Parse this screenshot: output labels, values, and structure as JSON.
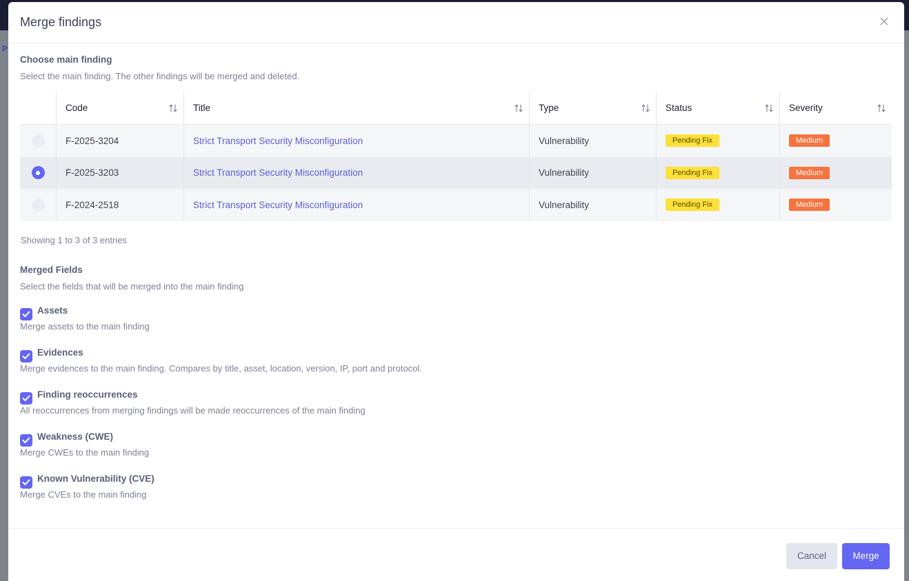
{
  "background": {
    "left_fragment": "P"
  },
  "modal": {
    "title": "Merge findings",
    "choose": {
      "title": "Choose main finding",
      "description": "Select the main finding. The other findings will be merged and deleted."
    },
    "table": {
      "columns": [
        "Code",
        "Title",
        "Type",
        "Status",
        "Severity"
      ],
      "rows": [
        {
          "code": "F-2025-3204",
          "title": "Strict Transport Security Misconfiguration",
          "type": "Vulnerability",
          "status": "Pending Fix",
          "severity": "Medium",
          "selected": false
        },
        {
          "code": "F-2025-3203",
          "title": "Strict Transport Security Misconfiguration",
          "type": "Vulnerability",
          "status": "Pending Fix",
          "severity": "Medium",
          "selected": true
        },
        {
          "code": "F-2024-2518",
          "title": "Strict Transport Security Misconfiguration",
          "type": "Vulnerability",
          "status": "Pending Fix",
          "severity": "Medium",
          "selected": false
        }
      ],
      "entries_info": "Showing 1 to 3 of 3 entries"
    },
    "merged_fields": {
      "title": "Merged Fields",
      "description": "Select the fields that will be merged into the main finding",
      "fields": [
        {
          "label": "Assets",
          "description": "Merge assets to the main finding",
          "checked": true
        },
        {
          "label": "Evidences",
          "description": "Merge evidences to the main finding. Compares by title, asset, location, version, IP, port and protocol.",
          "checked": true
        },
        {
          "label": "Finding reoccurrences",
          "description": "All reoccurrences from merging findings will be made reoccurrences of the main finding",
          "checked": true
        },
        {
          "label": "Weakness (CWE)",
          "description": "Merge CWEs to the main finding",
          "checked": true
        },
        {
          "label": "Known Vulnerability (CVE)",
          "description": "Merge CVEs to the main finding",
          "checked": true
        }
      ]
    },
    "footer": {
      "cancel_label": "Cancel",
      "merge_label": "Merge"
    }
  },
  "colors": {
    "accent": "#6466f1",
    "status_pending": "#fde03a",
    "severity_medium": "#f5743f",
    "link": "#5b61d6"
  }
}
